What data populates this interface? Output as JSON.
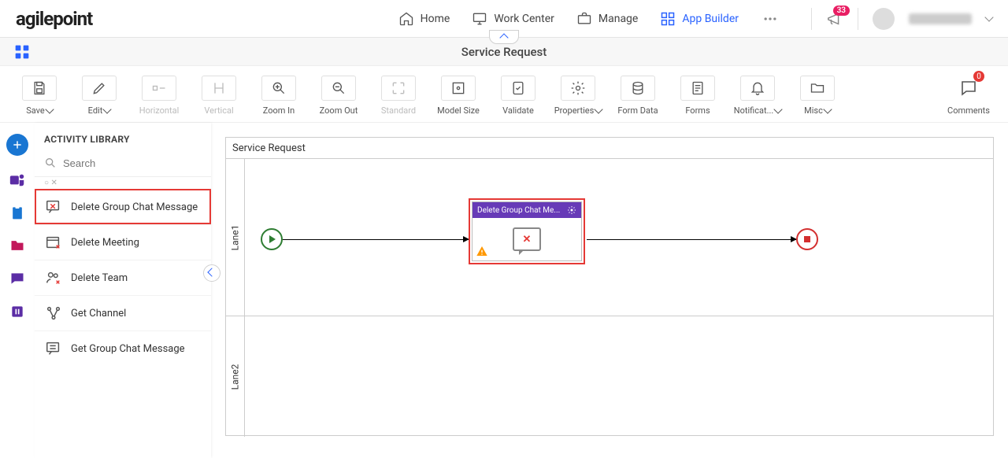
{
  "brand": "agilepoint",
  "nav": {
    "home": "Home",
    "work_center": "Work Center",
    "manage": "Manage",
    "app_builder": "App Builder"
  },
  "notifications_count": "33",
  "page_title": "Service Request",
  "toolbar": {
    "save": "Save",
    "edit": "Edit",
    "horizontal": "Horizontal",
    "vertical": "Vertical",
    "zoom_in": "Zoom In",
    "zoom_out": "Zoom Out",
    "standard": "Standard",
    "model_size": "Model Size",
    "validate": "Validate",
    "properties": "Properties",
    "form_data": "Form Data",
    "forms": "Forms",
    "notifications": "Notificat...",
    "misc": "Misc",
    "comments": "Comments",
    "comments_count": "0"
  },
  "library": {
    "header": "ACTIVITY LIBRARY",
    "search_placeholder": "Search",
    "items": [
      "Delete Group Chat Message",
      "Delete Meeting",
      "Delete Team",
      "Get Channel",
      "Get Group Chat Message"
    ]
  },
  "canvas": {
    "title": "Service Request",
    "lane1": "Lane1",
    "lane2": "Lane2",
    "activity_label": "Delete Group Chat Me..."
  }
}
